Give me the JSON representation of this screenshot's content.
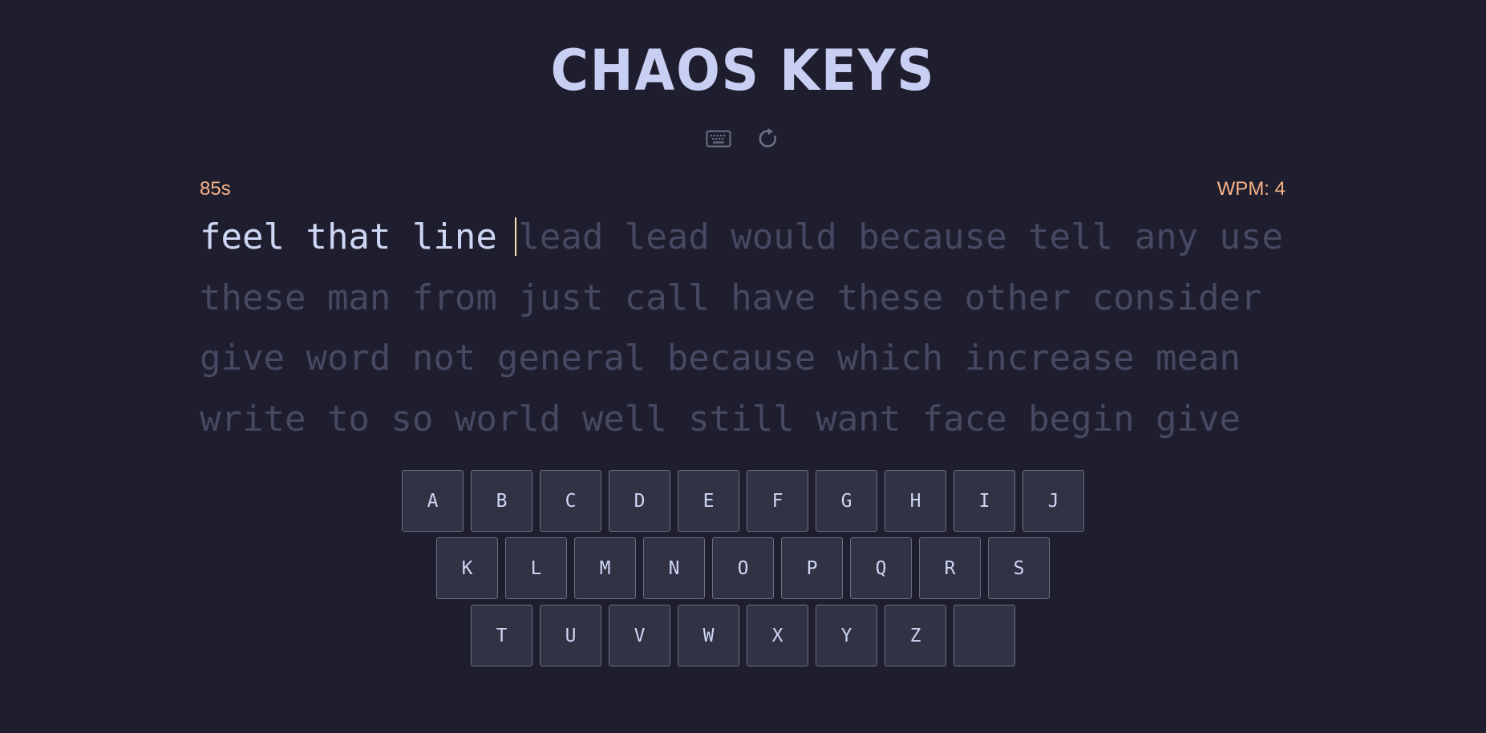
{
  "header": {
    "title": "CHAOS KEYS",
    "icons": [
      "keyboard-icon",
      "restart-icon"
    ]
  },
  "stats": {
    "timer": "85s",
    "wpm": "WPM: 4"
  },
  "typing": {
    "typed_text": "feel that line ",
    "pending_text": "lead lead would because tell any use these man from just call have these other consider give word not general because which increase mean write to so world well still want face begin give"
  },
  "keyboard": {
    "row1": [
      "A",
      "B",
      "C",
      "D",
      "E",
      "F",
      "G",
      "H",
      "I",
      "J"
    ],
    "row2": [
      "K",
      "L",
      "M",
      "N",
      "O",
      "P",
      "Q",
      "R",
      "S"
    ],
    "row3": [
      "T",
      "U",
      "V",
      "W",
      "X",
      "Y",
      "Z",
      ""
    ]
  },
  "colors": {
    "background": "#1f1e2e",
    "accent": "#fab387",
    "caret": "#f9e2af",
    "typed": "#cdd6f4",
    "pending": "#474861",
    "key_bg": "#313244",
    "key_border": "#6c6f85"
  }
}
